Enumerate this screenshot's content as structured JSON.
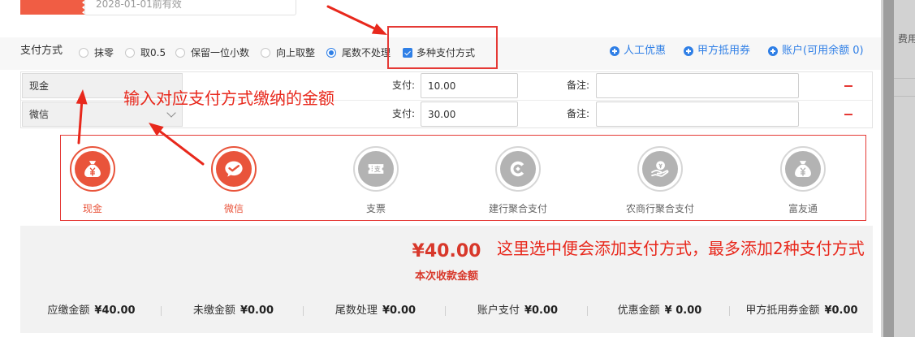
{
  "colors": {
    "accent_blue": "#2f7fe6",
    "brand_red": "#e9543b",
    "annotation_red": "#e8281c",
    "inactive_grey": "#b3b3b3"
  },
  "coupon": {
    "expiry": "2028-01-01前有效"
  },
  "payment_mode": {
    "label": "支付方式",
    "options": [
      {
        "label": "抹零",
        "selected": false
      },
      {
        "label": "取0.5",
        "selected": false
      },
      {
        "label": "保留一位小数",
        "selected": false
      },
      {
        "label": "向上取整",
        "selected": false
      },
      {
        "label": "尾数不处理",
        "selected": true
      }
    ],
    "multi_pay": {
      "label": "多种支付方式",
      "checked": true
    }
  },
  "actions": [
    {
      "label": "人工优惠",
      "icon": "plus-circle-icon"
    },
    {
      "label": "甲方抵用券",
      "icon": "plus-circle-icon"
    },
    {
      "label": "账户(可用余额 0)",
      "icon": "plus-circle-icon"
    }
  ],
  "payment_rows": [
    {
      "method": "现金",
      "amount_label": "支付:",
      "amount": "10.00",
      "note_label": "备注:",
      "note": "",
      "remove_icon": "minus-icon"
    },
    {
      "method": "微信",
      "amount_label": "支付:",
      "amount": "30.00",
      "note_label": "备注:",
      "note": "",
      "remove_icon": "minus-icon"
    }
  ],
  "methods": [
    {
      "name": "现金",
      "active": true,
      "icon": "money-bag-icon"
    },
    {
      "name": "微信",
      "active": true,
      "icon": "wechat-pay-icon"
    },
    {
      "name": "支票",
      "active": false,
      "icon": "cheque-icon",
      "icon_text": "支"
    },
    {
      "name": "建行聚合支付",
      "active": false,
      "icon": "ccb-logo-icon"
    },
    {
      "name": "农商行聚合支付",
      "active": false,
      "icon": "hand-coin-icon"
    },
    {
      "name": "富友通",
      "active": false,
      "icon": "money-bag-icon"
    }
  ],
  "summary": {
    "amount": "¥40.00",
    "amount_label": "本次收款金额",
    "items": [
      {
        "label": "应缴金额",
        "value": "¥40.00"
      },
      {
        "label": "未缴金额",
        "value": "¥0.00"
      },
      {
        "label": "尾数处理",
        "value": "¥0.00"
      },
      {
        "label": "账户支付",
        "value": "¥0.00"
      },
      {
        "label": "优惠金额",
        "value": "¥ 0.00"
      },
      {
        "label": "甲方抵用券金额",
        "value": "¥0.00"
      }
    ]
  },
  "annotations": {
    "amount_hint": "输入对应支付方式缴纳的金额",
    "method_hint": "这里选中便会添加支付方式，最多添加2种支付方式"
  },
  "background_page": {
    "column_label": "费用"
  }
}
